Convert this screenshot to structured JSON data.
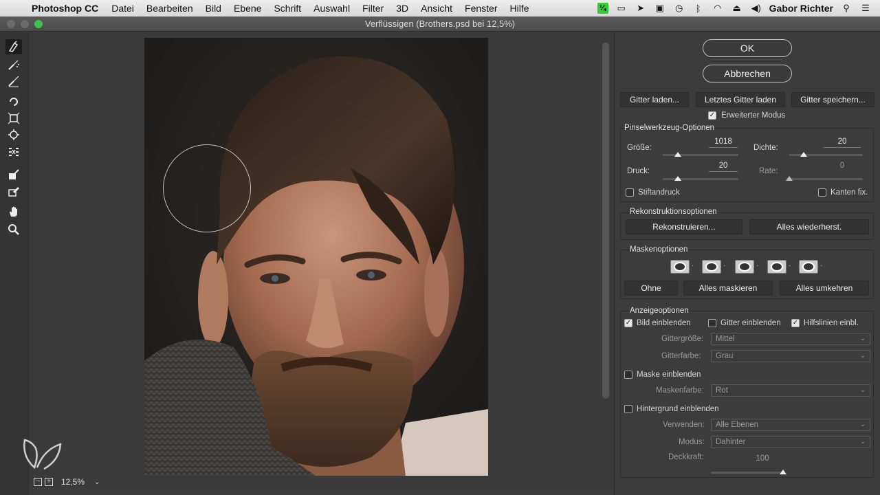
{
  "menubar": {
    "app_name": "Photoshop CC",
    "items": [
      "Datei",
      "Bearbeiten",
      "Bild",
      "Ebene",
      "Schrift",
      "Auswahl",
      "Filter",
      "3D",
      "Ansicht",
      "Fenster",
      "Hilfe"
    ],
    "user": "Gabor Richter"
  },
  "window": {
    "title": "Verflüssigen (Brothers.psd bei 12,5%)"
  },
  "zoom": {
    "value": "12,5%"
  },
  "panel": {
    "ok_label": "OK",
    "cancel_label": "Abbrechen",
    "load_mesh_label": "Gitter laden...",
    "load_last_mesh_label": "Letztes Gitter laden",
    "save_mesh_label": "Gitter speichern...",
    "advanced_mode_label": "Erweiterter Modus",
    "brush_options": {
      "title": "Pinselwerkzeug-Optionen",
      "size_label": "Größe:",
      "size_value": "1018",
      "size_fraction": 0.2,
      "density_label": "Dichte:",
      "density_value": "20",
      "density_fraction": 0.2,
      "pressure_label": "Druck:",
      "pressure_value": "20",
      "pressure_fraction": 0.2,
      "rate_label": "Rate:",
      "rate_value": "0",
      "rate_fraction": 0,
      "stylus_label": "Stiftandruck",
      "pin_edges_label": "Kanten fix."
    },
    "reconstruct": {
      "title": "Rekonstruktionsoptionen",
      "reconstruct_label": "Rekonstruieren...",
      "restore_all_label": "Alles wiederherst."
    },
    "mask": {
      "title": "Maskenoptionen",
      "none_label": "Ohne",
      "mask_all_label": "Alles maskieren",
      "invert_all_label": "Alles umkehren"
    },
    "view": {
      "title": "Anzeigeoptionen",
      "show_image_label": "Bild einblenden",
      "show_mesh_label": "Gitter einblenden",
      "show_guides_label": "Hilfslinien einbl.",
      "mesh_size_label": "Gittergröße:",
      "mesh_size_value": "Mittel",
      "mesh_color_label": "Gitterfarbe:",
      "mesh_color_value": "Grau",
      "show_mask_label": "Maske einblenden",
      "mask_color_label": "Maskenfarbe:",
      "mask_color_value": "Rot",
      "show_backdrop_label": "Hintergrund einblenden",
      "use_label": "Verwenden:",
      "use_value": "Alle Ebenen",
      "mode_label": "Modus:",
      "mode_value": "Dahinter",
      "opacity_label": "Deckkraft:",
      "opacity_value": "100",
      "opacity_fraction": 1.0
    }
  }
}
